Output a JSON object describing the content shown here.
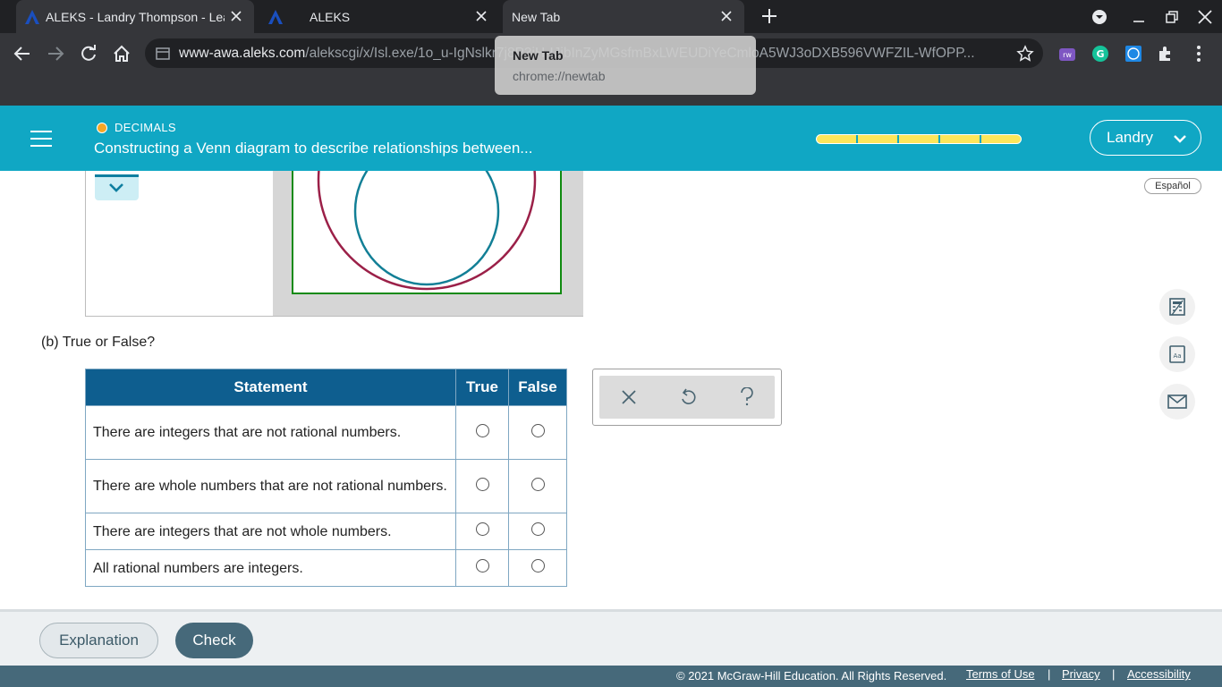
{
  "browser": {
    "tabs": [
      {
        "title": "ALEKS - Landry Thompson - Lear",
        "active": true
      },
      {
        "title": "ALEKS",
        "active": false
      },
      {
        "title": "New Tab",
        "active": true
      }
    ],
    "url_host": "www-awa.aleks.com",
    "url_path": "/alekscgi/x/Isl.exe/1o_u-IgNslkr7j8P3jH-IJjbInZyMGsfmBxLWEUDiYeCmloA5WJ3oDXB596VWFZIL-WfOPP...",
    "tooltip": {
      "title": "New Tab",
      "url": "chrome://newtab"
    }
  },
  "header": {
    "topic_label": "DECIMALS",
    "title": "Constructing a Venn diagram to describe relationships between...",
    "progress_segments": 5,
    "user_name": "Landry"
  },
  "content": {
    "espanol": "Español",
    "part_label": "(b)  True or False?",
    "table": {
      "headers": [
        "Statement",
        "True",
        "False"
      ],
      "rows": [
        {
          "statement": "There are integers that are not rational numbers."
        },
        {
          "statement": "There are whole numbers that are not rational numbers."
        },
        {
          "statement": "There are integers that are not whole numbers."
        },
        {
          "statement": "All rational numbers are integers."
        }
      ]
    },
    "tools": [
      "calculator-icon",
      "dictionary-icon",
      "mail-icon"
    ],
    "answer_tools": [
      "close-icon",
      "undo-icon",
      "help-icon"
    ],
    "venn_colors": {
      "outer": "#9b2048",
      "inner": "#127f96",
      "frame": "#108a10"
    }
  },
  "footer": {
    "explanation_label": "Explanation",
    "check_label": "Check",
    "copyright": "© 2021 McGraw-Hill Education. All Rights Reserved.",
    "links": [
      "Terms of Use",
      "Privacy",
      "Accessibility"
    ],
    "separator": "|"
  },
  "colors": {
    "header_bg": "#10a7c4",
    "table_header": "#0e5e8f",
    "check_button": "#46697a",
    "progress": "#fde65b"
  }
}
